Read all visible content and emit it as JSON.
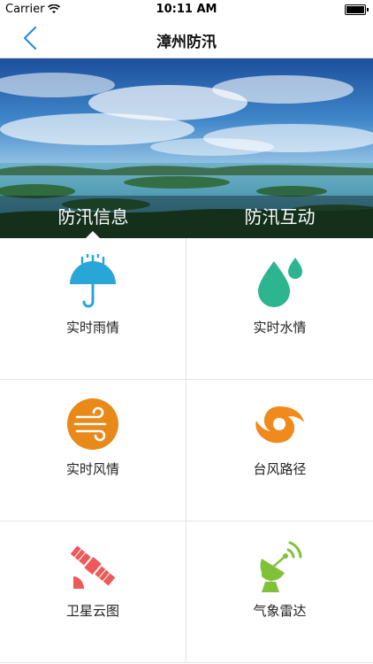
{
  "status_bar": {
    "carrier": "Carrier",
    "time": "10:11 AM"
  },
  "nav": {
    "title": "漳州防汛",
    "back_icon": "chevron-left-icon"
  },
  "hero": {
    "tabs": [
      {
        "label": "防汛信息",
        "selected": true
      },
      {
        "label": "防汛互动",
        "selected": false
      }
    ]
  },
  "grid": {
    "items": [
      {
        "label": "实时雨情",
        "icon": "umbrella-rain-icon",
        "color": "#29a6d8"
      },
      {
        "label": "实时水情",
        "icon": "water-drops-icon",
        "color": "#2cb58f"
      },
      {
        "label": "实时风情",
        "icon": "wind-icon",
        "color": "#e8891a"
      },
      {
        "label": "台风路径",
        "icon": "typhoon-icon",
        "color": "#f08a1c"
      },
      {
        "label": "卫星云图",
        "icon": "satellite-icon",
        "color": "#ee5a5a"
      },
      {
        "label": "气象雷达",
        "icon": "radar-dish-icon",
        "color": "#7fc23a"
      }
    ]
  }
}
